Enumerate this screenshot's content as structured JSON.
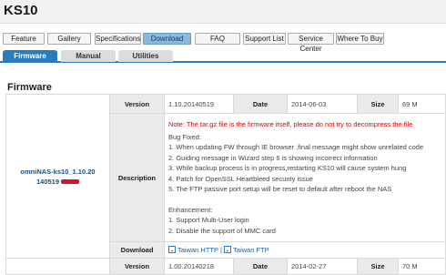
{
  "header": {
    "title": "KS10"
  },
  "tabs": [
    "Feature",
    "Gallery",
    "Specifications",
    "Download",
    "FAQ",
    "Support List",
    "Service Center",
    "Where To Buy"
  ],
  "active_tab": "Download",
  "subtabs": [
    "Firmware",
    "Manual",
    "Utilities"
  ],
  "active_subtab": "Firmware",
  "section_title": "Firmware",
  "firmware": {
    "name_line1": "omniNAS-ks10_1.10.20",
    "name_line2": "140519",
    "row1": {
      "version_label": "Version",
      "version": "1.10.20140519",
      "date_label": "Date",
      "date": "2014-06-03",
      "size_label": "Size",
      "size": "69 M"
    },
    "description_label": "Description",
    "note": "Note: The tar.gz file is the firmware itself, please do not try to decompress the file",
    "bug_fixed_title": "Bug Fixed:",
    "bugs": [
      "1. When updating FW through IE browser ,final message might show unrelated code",
      "2. Guiding message in Wizard step 6 is showing incorrect information",
      "3. While backup process is in progress,restarting KS10 will cause system hung",
      "4. Patch for OpenSSL Heartbleed security issue",
      "5. The FTP passive port setup will be reset to default after reboot the NAS"
    ],
    "enh_title": "Enhancement:",
    "enhancements": [
      "1. Support Multi-User login",
      "2. Disable the support of MMC card"
    ],
    "download_label": "Download",
    "links": [
      "Taiwan HTTP",
      "Taiwan FTP"
    ],
    "link_sep": "|",
    "row2": {
      "version_label": "Version",
      "version": "1.00.20140218",
      "date_label": "Date",
      "date": "2014-02-27",
      "size_label": "Size",
      "size": "70 M"
    }
  }
}
